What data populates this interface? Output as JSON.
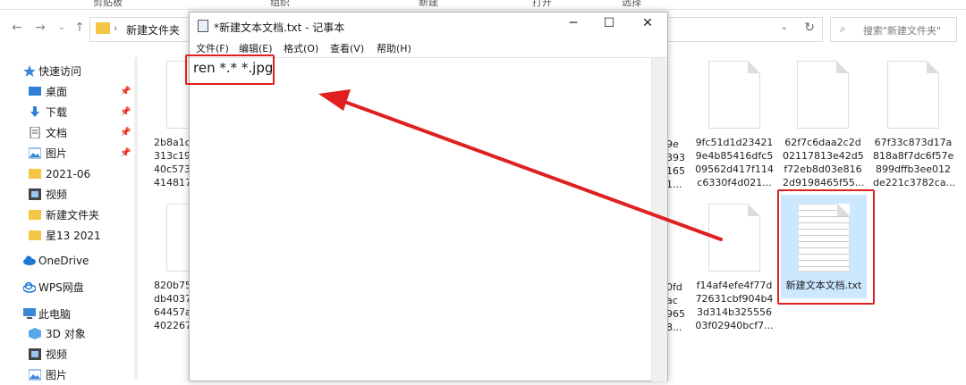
{
  "ribbon": {
    "items": [
      "剪贴板",
      "组织",
      "新建",
      "打开",
      "选择"
    ]
  },
  "address": {
    "path": "新建文件夹",
    "search_placeholder": "搜索\"新建文件夹\""
  },
  "sidebar": {
    "items": [
      {
        "label": "快速访问",
        "icon": "star-icon"
      },
      {
        "label": "桌面",
        "icon": "desktop-icon",
        "pinned": true
      },
      {
        "label": "下载",
        "icon": "download-icon",
        "pinned": true
      },
      {
        "label": "文档",
        "icon": "document-icon",
        "pinned": true
      },
      {
        "label": "图片",
        "icon": "picture-icon",
        "pinned": true
      },
      {
        "label": "2021-06",
        "icon": "folder-icon"
      },
      {
        "label": "视频",
        "icon": "video-icon"
      },
      {
        "label": "新建文件夹",
        "icon": "folder-icon"
      },
      {
        "label": "星13 2021",
        "icon": "folder-icon"
      },
      {
        "label": "OneDrive",
        "icon": "cloud-icon"
      },
      {
        "label": "WPS网盘",
        "icon": "wps-cloud-icon"
      },
      {
        "label": "此电脑",
        "icon": "computer-icon"
      },
      {
        "label": "3D 对象",
        "icon": "3d-icon"
      },
      {
        "label": "视频",
        "icon": "video-icon"
      },
      {
        "label": "图片",
        "icon": "picture-icon"
      }
    ]
  },
  "files": {
    "row1_left": "2b8a1c\n313c19\n40c573\n414817",
    "row1_partial": "9e\n393\n165\n1...",
    "row1_a": "9fc51d1d23421\n9e4b85416dfc5\n09562d417f114\nc6330f4d021...",
    "row1_b": "62f7c6daa2c2d\n02117813e42d5\nf72eb8d03e816\n2d9198465f55...",
    "row1_c": "67f33c873d17a\n818a8f7dc6f57e\n899dffb3ee012\nde221c3782ca...",
    "row2_left": "820b75\ndb4037\n64457a\n402267",
    "row2_partial": "0fd\nac\n965\n8...",
    "row2_a": "f14af4efe4f77d\n72631cbf904b4\n3d314b325556\n03f02940bcf7...",
    "row2_selected": "新建文本文档.txt"
  },
  "notepad": {
    "title": "*新建文本文档.txt - 记事本",
    "menu": [
      "文件(F)",
      "编辑(E)",
      "格式(O)",
      "查看(V)",
      "帮助(H)"
    ],
    "content": "ren *.* *.jpg"
  },
  "colors": {
    "annotation": "#e02020",
    "selection": "#cce8ff"
  }
}
